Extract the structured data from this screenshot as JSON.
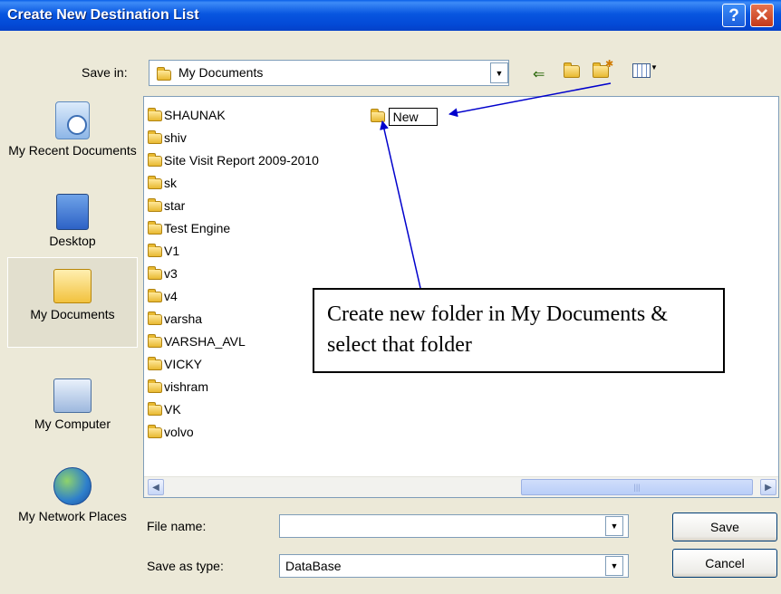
{
  "window": {
    "title": "Create New Destination List",
    "help_label": "?",
    "close_label": "✕"
  },
  "toolbar": {
    "save_in_label": "Save in:",
    "save_in_value": "My Documents"
  },
  "places": [
    {
      "label": "My Recent Documents",
      "icon": "recent-documents-icon"
    },
    {
      "label": "Desktop",
      "icon": "desktop-icon"
    },
    {
      "label": "My Documents",
      "icon": "my-documents-icon",
      "selected": true
    },
    {
      "label": "My Computer",
      "icon": "my-computer-icon"
    },
    {
      "label": "My Network Places",
      "icon": "network-places-icon"
    }
  ],
  "folders": [
    "SHAUNAK",
    "shiv",
    "Site Visit Report 2009-2010",
    "sk",
    "star",
    "Test Engine",
    "V1",
    "v3",
    "v4",
    "varsha",
    "VARSHA_AVL",
    "VICKY",
    "vishram",
    "VK",
    "volvo"
  ],
  "new_folder": {
    "name": "New"
  },
  "form": {
    "file_name_label": "File name:",
    "file_name_value": "",
    "save_as_type_label": "Save as type:",
    "save_as_type_value": "DataBase"
  },
  "buttons": {
    "save": "Save",
    "cancel": "Cancel"
  },
  "annotation": {
    "text": "Create new folder in My Documents & select that folder"
  },
  "colors": {
    "titlebar": "#0454E3",
    "dialog_bg": "#ECE9D8",
    "arrow": "#0000CC"
  }
}
